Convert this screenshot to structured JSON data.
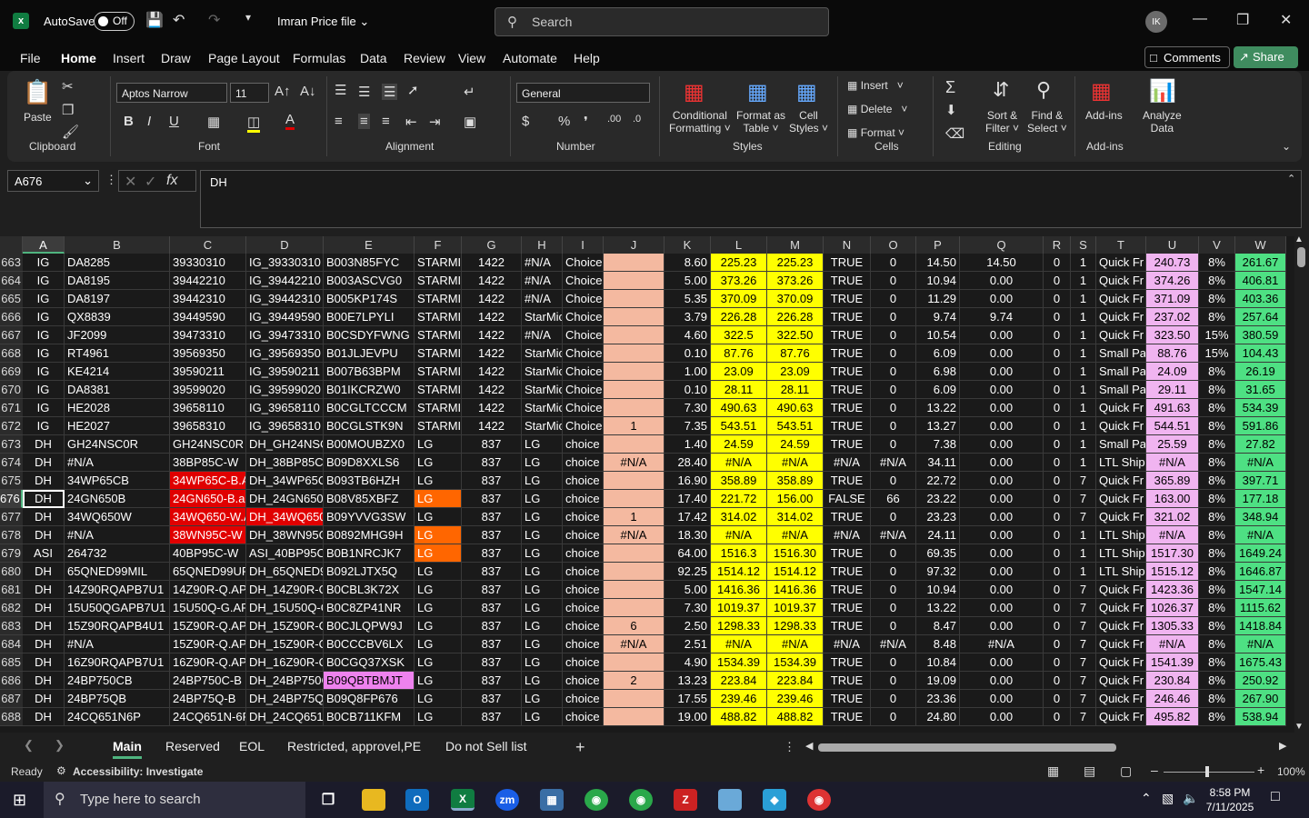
{
  "titlebar": {
    "logo": "x",
    "autosave_label": "AutoSave",
    "autosave_state": "Off",
    "file_name": "Imran Price file",
    "search_placeholder": "Search",
    "avatar_initials": "IK"
  },
  "menu": [
    "File",
    "Home",
    "Insert",
    "Draw",
    "Page Layout",
    "Formulas",
    "Data",
    "Review",
    "View",
    "Automate",
    "Help"
  ],
  "actions": {
    "comments": "Comments",
    "share": "Share"
  },
  "ribbon": {
    "paste": "Paste",
    "clipboard": "Clipboard",
    "font_name": "Aptos Narrow",
    "font_size": "11",
    "font": "Font",
    "alignment": "Alignment",
    "number_format": "General",
    "number": "Number",
    "conditional": "Conditional",
    "formatting": "Formatting",
    "format_as": "Format as",
    "table": "Table",
    "cell": "Cell",
    "styles_btn": "Styles",
    "styles": "Styles",
    "insert": "Insert",
    "delete": "Delete",
    "format": "Format",
    "cells": "Cells",
    "sort": "Sort &",
    "filter": "Filter",
    "find": "Find &",
    "select": "Select",
    "editing": "Editing",
    "addins_btn": "Add-ins",
    "addins": "Add-ins",
    "analyze": "Analyze",
    "data": "Data"
  },
  "formula_bar": {
    "name_box": "A676",
    "formula": "DH"
  },
  "columns": [
    "A",
    "B",
    "C",
    "D",
    "E",
    "F",
    "G",
    "H",
    "I",
    "J",
    "K",
    "L",
    "M",
    "N",
    "O",
    "P",
    "Q",
    "R",
    "S",
    "T",
    "U",
    "V",
    "W"
  ],
  "rows": [
    {
      "n": "663",
      "c": [
        "IG",
        "DA8285",
        "39330310",
        "IG_39330310",
        "B003N85FYC",
        "STARMIC",
        "1422",
        "#N/A",
        "Choice",
        "",
        "8.60",
        "225.23",
        "225.23",
        "TRUE",
        "0",
        "14.50",
        "14.50",
        "0",
        "1",
        "Quick Fr",
        "240.73",
        "8%",
        "261.67"
      ]
    },
    {
      "n": "664",
      "c": [
        "IG",
        "DA8195",
        "39442210",
        "IG_39442210",
        "B003ASCVG0",
        "STARMIC",
        "1422",
        "#N/A",
        "Choice",
        "",
        "5.00",
        "373.26",
        "373.26",
        "TRUE",
        "0",
        "10.94",
        "0.00",
        "0",
        "1",
        "Quick Fr",
        "374.26",
        "8%",
        "406.81"
      ]
    },
    {
      "n": "665",
      "c": [
        "IG",
        "DA8197",
        "39442310",
        "IG_39442310",
        "B005KP174S",
        "STARMIC",
        "1422",
        "#N/A",
        "Choice",
        "",
        "5.35",
        "370.09",
        "370.09",
        "TRUE",
        "0",
        "11.29",
        "0.00",
        "0",
        "1",
        "Quick Fr",
        "371.09",
        "8%",
        "403.36"
      ]
    },
    {
      "n": "666",
      "c": [
        "IG",
        "QX8839",
        "39449590",
        "IG_39449590",
        "B00E7LPYLI",
        "STARMIC",
        "1422",
        "StarMic",
        "Choice",
        "",
        "3.79",
        "226.28",
        "226.28",
        "TRUE",
        "0",
        "9.74",
        "9.74",
        "0",
        "1",
        "Quick Fr",
        "237.02",
        "8%",
        "257.64"
      ]
    },
    {
      "n": "667",
      "c": [
        "IG",
        "JF2099",
        "39473310",
        "IG_39473310",
        "B0CSDYFWNG",
        "STARMIC",
        "1422",
        "#N/A",
        "Choice",
        "",
        "4.60",
        "322.5",
        "322.50",
        "TRUE",
        "0",
        "10.54",
        "0.00",
        "0",
        "1",
        "Quick Fr",
        "323.50",
        "15%",
        "380.59"
      ]
    },
    {
      "n": "668",
      "c": [
        "IG",
        "RT4961",
        "39569350",
        "IG_39569350",
        "B01JLJEVPU",
        "STARMIC",
        "1422",
        "StarMic",
        "Choice",
        "",
        "0.10",
        "87.76",
        "87.76",
        "TRUE",
        "0",
        "6.09",
        "0.00",
        "0",
        "1",
        "Small Pa",
        "88.76",
        "15%",
        "104.43"
      ]
    },
    {
      "n": "669",
      "c": [
        "IG",
        "KE4214",
        "39590211",
        "IG_39590211",
        "B007B63BPM",
        "STARMIC",
        "1422",
        "StarMic",
        "Choice",
        "",
        "1.00",
        "23.09",
        "23.09",
        "TRUE",
        "0",
        "6.98",
        "0.00",
        "0",
        "1",
        "Small Pa",
        "24.09",
        "8%",
        "26.19"
      ]
    },
    {
      "n": "670",
      "c": [
        "IG",
        "DA8381",
        "39599020",
        "IG_39599020",
        "B01IKCRZW0",
        "STARMIC",
        "1422",
        "StarMic",
        "Choice",
        "",
        "0.10",
        "28.11",
        "28.11",
        "TRUE",
        "0",
        "6.09",
        "0.00",
        "0",
        "1",
        "Small Pa",
        "29.11",
        "8%",
        "31.65"
      ]
    },
    {
      "n": "671",
      "c": [
        "IG",
        "HE2028",
        "39658110",
        "IG_39658110",
        "B0CGLTCCCM",
        "STARMIC",
        "1422",
        "StarMic",
        "Choice",
        "",
        "7.30",
        "490.63",
        "490.63",
        "TRUE",
        "0",
        "13.22",
        "0.00",
        "0",
        "1",
        "Quick Fr",
        "491.63",
        "8%",
        "534.39"
      ]
    },
    {
      "n": "672",
      "c": [
        "IG",
        "HE2027",
        "39658310",
        "IG_39658310",
        "B0CGLSTK9N",
        "STARMIC",
        "1422",
        "StarMic",
        "Choice",
        "1",
        "7.35",
        "543.51",
        "543.51",
        "TRUE",
        "0",
        "13.27",
        "0.00",
        "0",
        "1",
        "Quick Fr",
        "544.51",
        "8%",
        "591.86"
      ]
    },
    {
      "n": "673",
      "c": [
        "DH",
        "GH24NSC0R",
        "GH24NSC0R",
        "DH_GH24NSC",
        "B00MOUBZX0",
        "LG",
        "837",
        "LG",
        "choice",
        "",
        "1.40",
        "24.59",
        "24.59",
        "TRUE",
        "0",
        "7.38",
        "0.00",
        "0",
        "1",
        "Small Pa",
        "25.59",
        "8%",
        "27.82"
      ]
    },
    {
      "n": "674",
      "c": [
        "DH",
        "#N/A",
        "38BP85C-W",
        "DH_38BP85C-",
        "B09D8XXLS6",
        "LG",
        "837",
        "LG",
        "choice",
        "#N/A",
        "28.40",
        "#N/A",
        "#N/A",
        "#N/A",
        "#N/A",
        "34.11",
        "0.00",
        "0",
        "1",
        "LTL Ship",
        "#N/A",
        "8%",
        "#N/A"
      ]
    },
    {
      "n": "675",
      "c": [
        "DH",
        "34WP65CB",
        "34WP65C-B.A",
        "DH_34WP65C",
        "B093TB6HZH",
        "LG",
        "837",
        "LG",
        "choice",
        "",
        "16.90",
        "358.89",
        "358.89",
        "TRUE",
        "0",
        "22.72",
        "0.00",
        "0",
        "7",
        "Quick Fr",
        "365.89",
        "8%",
        "397.71"
      ]
    },
    {
      "n": "676",
      "c": [
        "DH",
        "24GN650B",
        "24GN650-B.a",
        "DH_24GN650-",
        "B08V85XBFZ",
        "LG",
        "837",
        "LG",
        "choice",
        "",
        "17.40",
        "221.72",
        "156.00",
        "FALSE",
        "66",
        "23.22",
        "0.00",
        "0",
        "7",
        "Quick Fr",
        "163.00",
        "8%",
        "177.18"
      ]
    },
    {
      "n": "677",
      "c": [
        "DH",
        "34WQ650W",
        "34WQ650-W.A",
        "DH_34WQ650",
        "B09YVVG3SW",
        "LG",
        "837",
        "LG",
        "choice",
        "1",
        "17.42",
        "314.02",
        "314.02",
        "TRUE",
        "0",
        "23.23",
        "0.00",
        "0",
        "7",
        "Quick Fr",
        "321.02",
        "8%",
        "348.94"
      ]
    },
    {
      "n": "678",
      "c": [
        "DH",
        "#N/A",
        "38WN95C-W",
        "DH_38WN95C",
        "B0892MHG9H",
        "LG",
        "837",
        "LG",
        "choice",
        "#N/A",
        "18.30",
        "#N/A",
        "#N/A",
        "#N/A",
        "#N/A",
        "24.11",
        "0.00",
        "0",
        "1",
        "LTL Ship",
        "#N/A",
        "8%",
        "#N/A"
      ]
    },
    {
      "n": "679",
      "c": [
        "ASI",
        "264732",
        "40BP95C-W",
        "ASI_40BP95C-",
        "B0B1NRCJK7",
        "LG",
        "837",
        "LG",
        "choice",
        "",
        "64.00",
        "1516.3",
        "1516.30",
        "TRUE",
        "0",
        "69.35",
        "0.00",
        "0",
        "1",
        "LTL Ship",
        "1517.30",
        "8%",
        "1649.24"
      ]
    },
    {
      "n": "680",
      "c": [
        "DH",
        "65QNED99MIL",
        "65QNED99UP",
        "DH_65QNED9",
        "B092LJTX5Q",
        "LG",
        "837",
        "LG",
        "choice",
        "",
        "92.25",
        "1514.12",
        "1514.12",
        "TRUE",
        "0",
        "97.32",
        "0.00",
        "0",
        "1",
        "LTL Ship",
        "1515.12",
        "8%",
        "1646.87"
      ]
    },
    {
      "n": "681",
      "c": [
        "DH",
        "14Z90RQAPB7U1",
        "14Z90R-Q.AP",
        "DH_14Z90R-Q",
        "B0CBL3K72X",
        "LG",
        "837",
        "LG",
        "choice",
        "",
        "5.00",
        "1416.36",
        "1416.36",
        "TRUE",
        "0",
        "10.94",
        "0.00",
        "0",
        "7",
        "Quick Fr",
        "1423.36",
        "8%",
        "1547.14"
      ]
    },
    {
      "n": "682",
      "c": [
        "DH",
        "15U50QGAPB7U1",
        "15U50Q-G.AP",
        "DH_15U50Q-G",
        "B0C8ZP41NR",
        "LG",
        "837",
        "LG",
        "choice",
        "",
        "7.30",
        "1019.37",
        "1019.37",
        "TRUE",
        "0",
        "13.22",
        "0.00",
        "0",
        "7",
        "Quick Fr",
        "1026.37",
        "8%",
        "1115.62"
      ]
    },
    {
      "n": "683",
      "c": [
        "DH",
        "15Z90RQAPB4U1",
        "15Z90R-Q.AP",
        "DH_15Z90R-Q",
        "B0CJLQPW9J",
        "LG",
        "837",
        "LG",
        "choice",
        "6",
        "2.50",
        "1298.33",
        "1298.33",
        "TRUE",
        "0",
        "8.47",
        "0.00",
        "0",
        "7",
        "Quick Fr",
        "1305.33",
        "8%",
        "1418.84"
      ]
    },
    {
      "n": "684",
      "c": [
        "DH",
        "#N/A",
        "15Z90R-Q.AP",
        "DH_15Z90R-Q",
        "B0CCCBV6LX",
        "LG",
        "837",
        "LG",
        "choice",
        "#N/A",
        "2.51",
        "#N/A",
        "#N/A",
        "#N/A",
        "#N/A",
        "8.48",
        "#N/A",
        "0",
        "7",
        "Quick Fr",
        "#N/A",
        "8%",
        "#N/A"
      ]
    },
    {
      "n": "685",
      "c": [
        "DH",
        "16Z90RQAPB7U1",
        "16Z90R-Q.AP",
        "DH_16Z90R-Q",
        "B0CGQ37XSK",
        "LG",
        "837",
        "LG",
        "choice",
        "",
        "4.90",
        "1534.39",
        "1534.39",
        "TRUE",
        "0",
        "10.84",
        "0.00",
        "0",
        "7",
        "Quick Fr",
        "1541.39",
        "8%",
        "1675.43"
      ]
    },
    {
      "n": "686",
      "c": [
        "DH",
        "24BP750CB",
        "24BP750C-B",
        "DH_24BP750C",
        "B09QBTBMJT",
        "LG",
        "837",
        "LG",
        "choice",
        "2",
        "13.23",
        "223.84",
        "223.84",
        "TRUE",
        "0",
        "19.09",
        "0.00",
        "0",
        "7",
        "Quick Fr",
        "230.84",
        "8%",
        "250.92"
      ]
    },
    {
      "n": "687",
      "c": [
        "DH",
        "24BP75QB",
        "24BP75Q-B",
        "DH_24BP75Q-",
        "B09Q8FP676",
        "LG",
        "837",
        "LG",
        "choice",
        "",
        "17.55",
        "239.46",
        "239.46",
        "TRUE",
        "0",
        "23.36",
        "0.00",
        "0",
        "7",
        "Quick Fr",
        "246.46",
        "8%",
        "267.90"
      ]
    },
    {
      "n": "688",
      "c": [
        "DH",
        "24CQ651N6P",
        "24CQ651N-6F",
        "DH_24CQ651N",
        "B0CB711KFM",
        "LG",
        "837",
        "LG",
        "choice",
        "",
        "19.00",
        "488.82",
        "488.82",
        "TRUE",
        "0",
        "24.80",
        "0.00",
        "0",
        "7",
        "Quick Fr",
        "495.82",
        "8%",
        "538.94"
      ]
    }
  ],
  "sheet_tabs": [
    "Main",
    "Reserved",
    "EOL",
    "Restricted, approvel,PE",
    "Do not Sell list"
  ],
  "status": {
    "ready": "Ready",
    "accessibility": "Accessibility: Investigate",
    "zoom": "100%"
  },
  "taskbar": {
    "search_placeholder": "Type here to search",
    "time": "8:58 PM",
    "date": "7/11/2025"
  },
  "colors": {
    "accent": "#4fb47f",
    "red_fill": "#e00000",
    "orange_fill": "#ff6600",
    "yellow_fill": "#ffff00",
    "peach_fill": "#f4b9a0",
    "pink_fill": "#f0b4f0",
    "green_fill": "#4ee083"
  }
}
